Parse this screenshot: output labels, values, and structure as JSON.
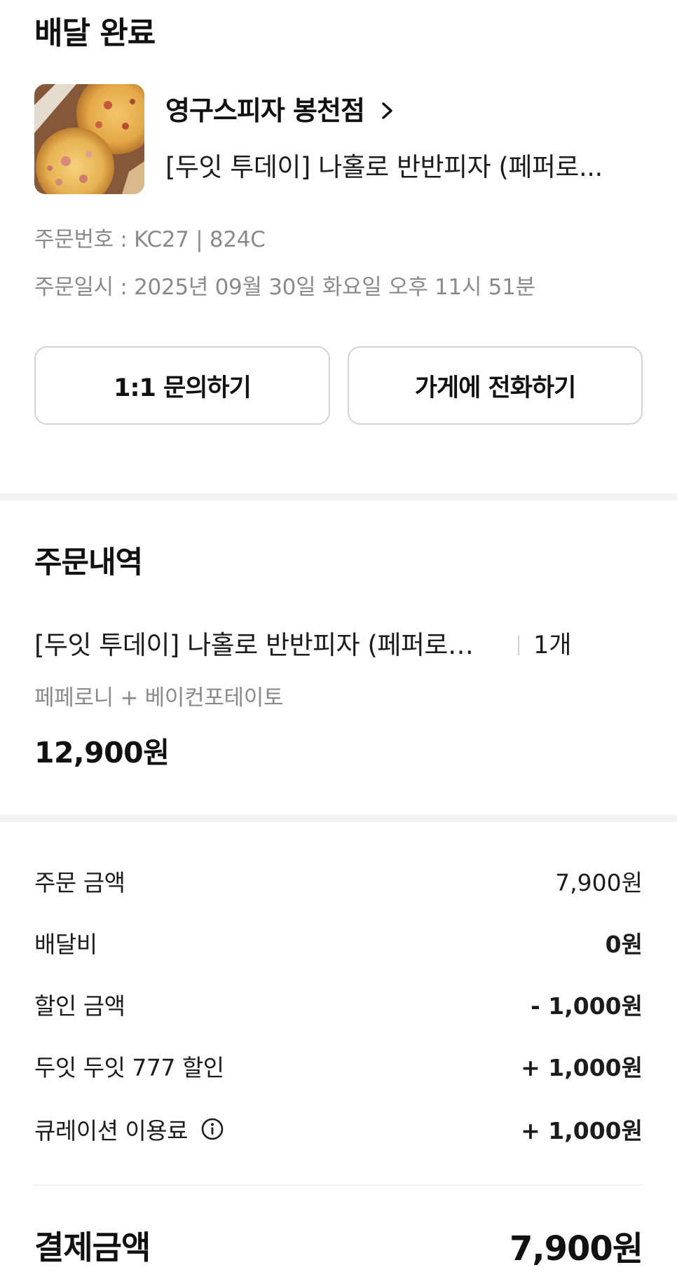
{
  "header": {
    "status_title": "배달 완료"
  },
  "store": {
    "name": "영구스피자 봉천점",
    "thumbnail_icon": "pizza-photo",
    "chevron_icon": "chevron-right-icon",
    "menu_summary": "[두잇 투데이] 나홀로 반반피자 (페퍼로..."
  },
  "order_info": {
    "number": "주문번호 : KC27 | 824C",
    "date": "주문일시 : 2025년 09월 30일 화요일 오후 11시 51분"
  },
  "actions": {
    "inquiry_label": "1:1 문의하기",
    "call_label": "가게에 전화하기"
  },
  "order_details": {
    "title": "주문내역",
    "items": [
      {
        "name": "[두잇 투데이] 나홀로 반반피자 (페퍼로니...",
        "quantity": "1개",
        "options": "페페로니 + 베이컨포테이토",
        "price": "12,900원"
      }
    ]
  },
  "payment": {
    "rows": [
      {
        "label": "주문 금액",
        "value": "7,900원"
      },
      {
        "label": "배달비",
        "value": "0원"
      },
      {
        "label": "할인 금액",
        "value": "- 1,000원"
      },
      {
        "label": "두잇 두잇 777 할인",
        "value": "+ 1,000원"
      },
      {
        "label": "큐레이션 이용료",
        "value": "+ 1,000원"
      }
    ],
    "info_icon": "info-circle-icon",
    "total_label": "결제금액",
    "total_value": "7,900원"
  }
}
